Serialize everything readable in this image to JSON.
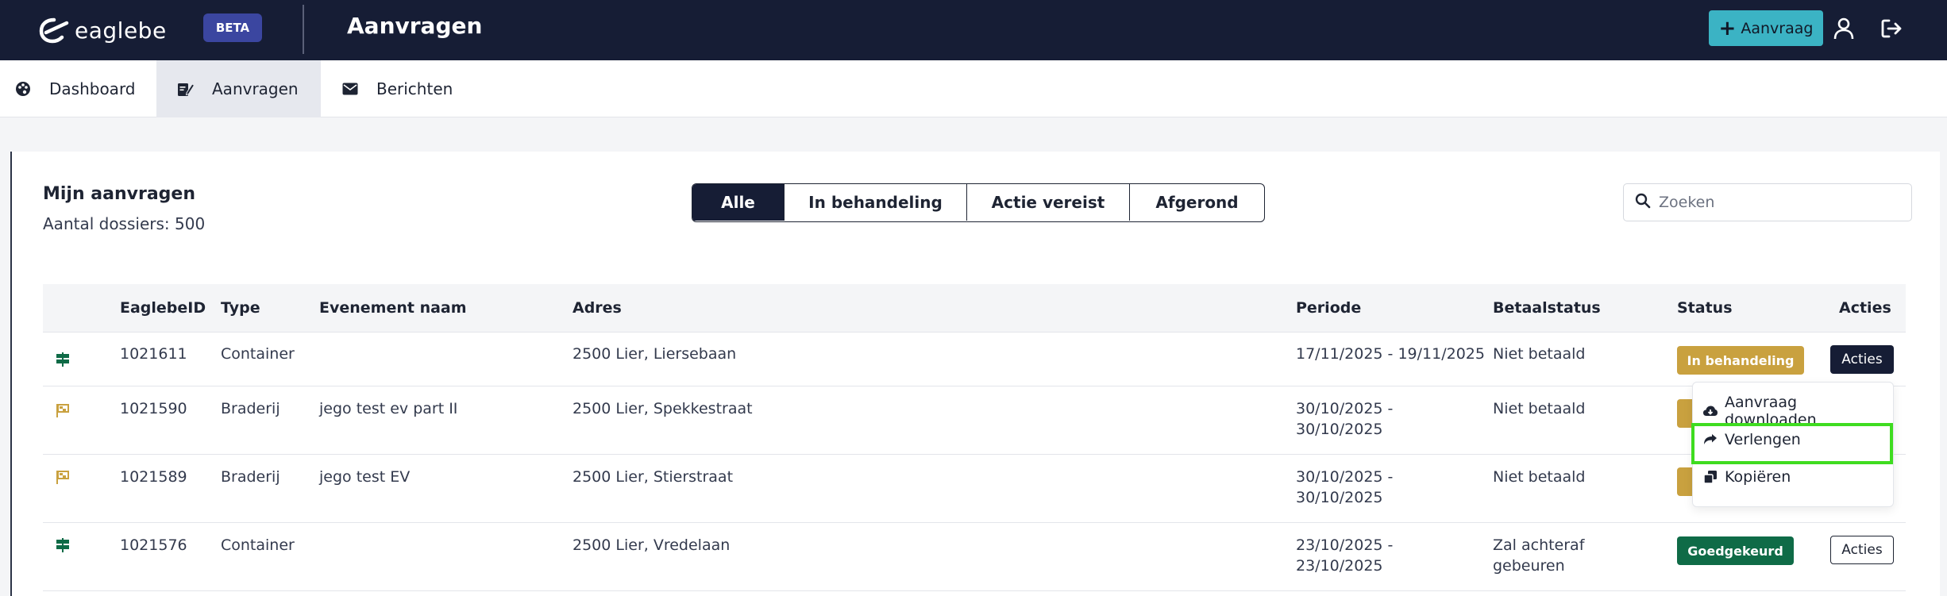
{
  "header": {
    "logo_text": "eaglebe",
    "beta_label": "BETA",
    "title": "Aanvragen",
    "new_button_label": "Aanvraag",
    "colors": {
      "bar": "#161d35",
      "accent": "#3bb3c4"
    }
  },
  "nav": {
    "items": [
      {
        "label": "Dashboard",
        "icon": "palette-icon"
      },
      {
        "label": "Aanvragen",
        "icon": "edit-document-icon",
        "active": true
      },
      {
        "label": "Berichten",
        "icon": "envelope-icon"
      }
    ]
  },
  "main": {
    "title": "Mijn aanvragen",
    "subtitle": "Aantal dossiers: 500",
    "filters": [
      "Alle",
      "In behandeling",
      "Actie vereist",
      "Afgerond"
    ],
    "active_filter": "Alle",
    "search_placeholder": "Zoeken"
  },
  "table": {
    "columns": [
      "EaglebeID",
      "Type",
      "Evenement naam",
      "Adres",
      "Periode",
      "Betaalstatus",
      "Status",
      "Acties"
    ],
    "rows": [
      {
        "icon": "signpost-icon",
        "id": "1021611",
        "type": "Container",
        "event": "",
        "address": "2500 Lier, Liersebaan",
        "period_line1": "17/11/2025 - 19/11/2025",
        "period_line2": "",
        "payment_line1": "Niet betaald",
        "payment_line2": "",
        "status": "In behandeling",
        "status_color": "#c9a13f",
        "actions": "Acties"
      },
      {
        "icon": "flag-icon",
        "id": "1021590",
        "type": "Braderij",
        "event": "jego test ev part II",
        "address": "2500 Lier, Spekkestraat",
        "period_line1": "30/10/2025 -",
        "period_line2": "30/10/2025",
        "payment_line1": "Niet betaald",
        "payment_line2": "",
        "status": "",
        "status_color": "#c9a13f",
        "actions": ""
      },
      {
        "icon": "flag-icon",
        "id": "1021589",
        "type": "Braderij",
        "event": "jego test EV",
        "address": "2500 Lier, Stierstraat",
        "period_line1": "30/10/2025 -",
        "period_line2": "30/10/2025",
        "payment_line1": "Niet betaald",
        "payment_line2": "",
        "status": "",
        "status_color": "#c9a13f",
        "actions": ""
      },
      {
        "icon": "signpost-icon",
        "id": "1021576",
        "type": "Container",
        "event": "",
        "address": "2500 Lier, Vredelaan",
        "period_line1": "23/10/2025 -",
        "period_line2": "23/10/2025",
        "payment_line1": "Zal achteraf",
        "payment_line2": "gebeuren",
        "status": "Goedgekeurd",
        "status_color": "#0f6b47",
        "actions": "Acties"
      }
    ]
  },
  "dropdown": {
    "items": [
      {
        "label": "Aanvraag downloaden",
        "icon": "cloud-download-icon"
      },
      {
        "label": "Verlengen",
        "icon": "share-arrow-icon"
      },
      {
        "label": "Kopiëren",
        "icon": "copy-icon"
      }
    ]
  }
}
